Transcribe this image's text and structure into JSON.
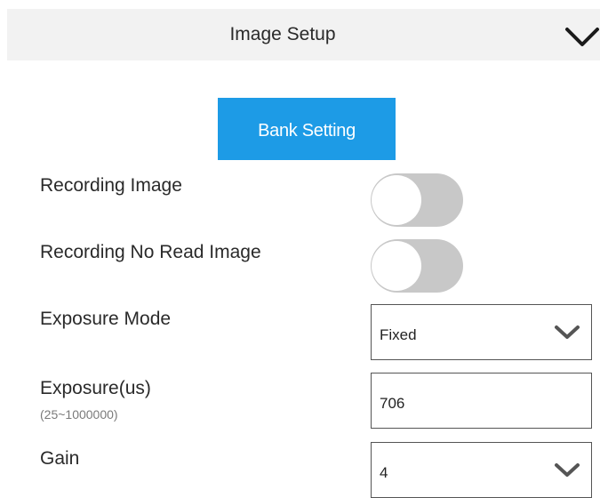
{
  "header": {
    "title": "Image Setup",
    "collapse_icon": "chevron-down-icon"
  },
  "bank_setting": {
    "label": "Bank Setting"
  },
  "recording_image": {
    "label": "Recording Image",
    "enabled": false
  },
  "recording_no_read_image": {
    "label": "Recording No Read Image",
    "enabled": false
  },
  "exposure_mode": {
    "label": "Exposure Mode",
    "value": "Fixed"
  },
  "exposure": {
    "label": "Exposure(us)",
    "range": "(25~1000000)",
    "value": "706"
  },
  "gain": {
    "label": "Gain",
    "value": "4"
  },
  "colors": {
    "accent": "#1d9be6",
    "toggle_off": "#c8c8c8",
    "header_bg": "#f2f2f2"
  }
}
